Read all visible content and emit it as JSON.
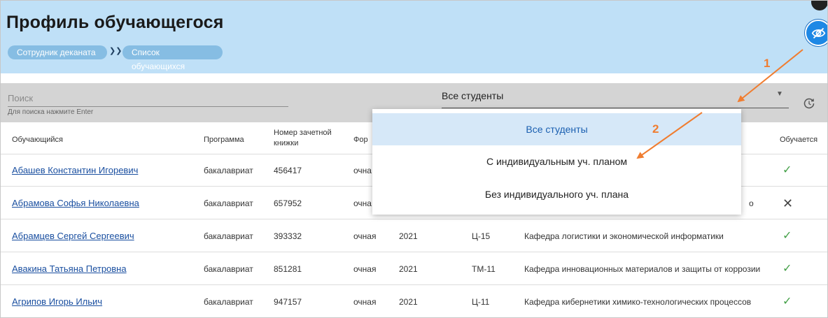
{
  "header": {
    "title": "Профиль обучающегося",
    "breadcrumbs": [
      "Сотрудник деканата",
      "Список обучающихся"
    ],
    "breadcrumb_separator": "❯❯"
  },
  "filter": {
    "search_placeholder": "Поиск",
    "search_hint": "Для поиска нажмите Enter",
    "select_value": "Все студенты"
  },
  "table": {
    "headers": {
      "student": "Обучающийся",
      "program": "Программа",
      "record_book": "Номер зачетной книжки",
      "form": "Фор",
      "status": "Обучается"
    },
    "rows": [
      {
        "name": "Абашев Константин Игоревич",
        "program": "бакалавриат",
        "record": "456417",
        "form": "очна",
        "year": "",
        "group": "",
        "dept": "",
        "status": "✓"
      },
      {
        "name": "Абрамова Софья Николаевна",
        "program": "бакалавриат",
        "record": "657952",
        "form": "очна",
        "year": "",
        "group": "",
        "dept": "",
        "status": "✕"
      },
      {
        "name": "Абрамцев Сергей Сергеевич",
        "program": "бакалавриат",
        "record": "393332",
        "form": "очная",
        "year": "2021",
        "group": "Ц-15",
        "dept": "Кафедра логистики и экономической информатики",
        "status": "✓"
      },
      {
        "name": "Авакина Татьяна Петровна",
        "program": "бакалавриат",
        "record": "851281",
        "form": "очная",
        "year": "2021",
        "group": "ТМ-11",
        "dept": "Кафедра инновационных материалов и защиты от коррозии",
        "status": "✓"
      },
      {
        "name": "Агрипов Игорь Ильич",
        "program": "бакалавриат",
        "record": "947157",
        "form": "очная",
        "year": "2021",
        "group": "Ц-11",
        "dept": "Кафедра кибернетики химико-технологических процессов",
        "status": "✓"
      }
    ]
  },
  "dropdown": {
    "options": [
      "Все студенты",
      "С индивидуальным уч. планом",
      "Без индивидуального уч. плана"
    ],
    "selected_index": 0
  },
  "annotations": {
    "step1": "1",
    "step2": "2",
    "color": "#f07d30"
  },
  "icons": {
    "visibility_toggle": "eye-off-icon",
    "refresh": "refresh-clock-icon",
    "select_caret": "caret-down-icon",
    "check": "check-icon",
    "cross": "close-icon"
  },
  "colors": {
    "header_bg": "#bfe0f7",
    "breadcrumb_bg": "#86bde3",
    "filter_bg": "#d4d4d4",
    "link": "#1a4fa0",
    "check_green": "#43a047",
    "selected_bg": "#d6e8f8"
  }
}
